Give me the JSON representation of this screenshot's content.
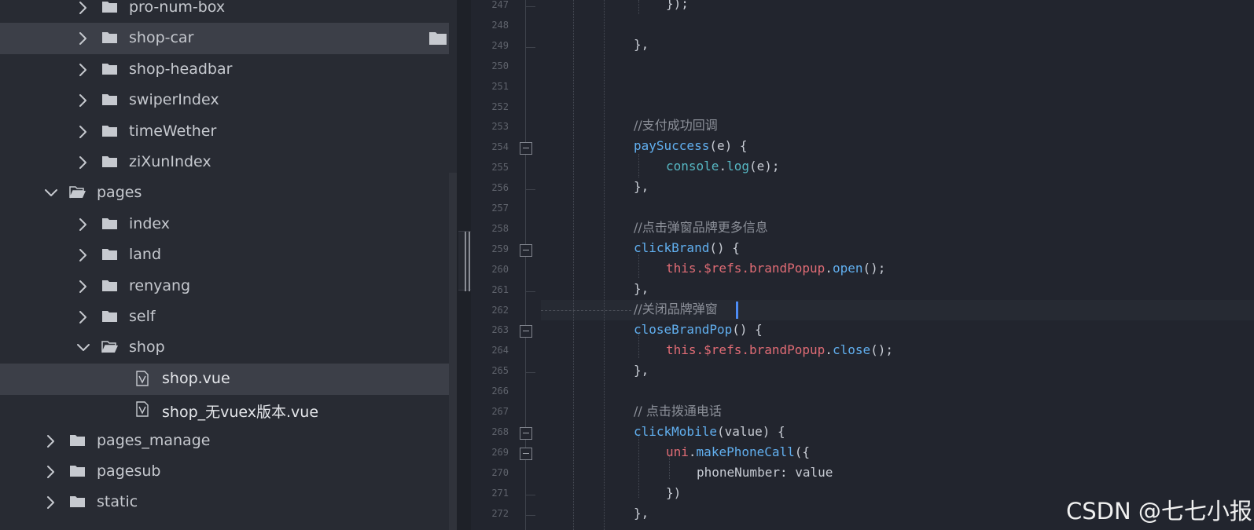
{
  "sidebar": {
    "items": [
      {
        "label": "pro-num-box",
        "type": "folder",
        "expanded": false,
        "depth": 2
      },
      {
        "label": "shop-car",
        "type": "folder",
        "expanded": false,
        "depth": 2,
        "selected": true
      },
      {
        "label": "shop-headbar",
        "type": "folder",
        "expanded": false,
        "depth": 2
      },
      {
        "label": "swiperIndex",
        "type": "folder",
        "expanded": false,
        "depth": 2
      },
      {
        "label": "timeWether",
        "type": "folder",
        "expanded": false,
        "depth": 2
      },
      {
        "label": "ziXunIndex",
        "type": "folder",
        "expanded": false,
        "depth": 2
      },
      {
        "label": "pages",
        "type": "folder",
        "expanded": true,
        "depth": 1
      },
      {
        "label": "index",
        "type": "folder",
        "expanded": false,
        "depth": 2
      },
      {
        "label": "land",
        "type": "folder",
        "expanded": false,
        "depth": 2
      },
      {
        "label": "renyang",
        "type": "folder",
        "expanded": false,
        "depth": 2
      },
      {
        "label": "self",
        "type": "folder",
        "expanded": false,
        "depth": 2
      },
      {
        "label": "shop",
        "type": "folder",
        "expanded": true,
        "depth": 2
      },
      {
        "label": "shop.vue",
        "type": "file",
        "depth": 3,
        "selected": true
      },
      {
        "label": "shop_无vuex版本.vue",
        "type": "file",
        "depth": 3
      },
      {
        "label": "pages_manage",
        "type": "folder",
        "expanded": false,
        "depth": 1
      },
      {
        "label": "pagesub",
        "type": "folder",
        "expanded": false,
        "depth": 1
      },
      {
        "label": "static",
        "type": "folder",
        "expanded": false,
        "depth": 1
      }
    ]
  },
  "editor": {
    "line_numbers": [
      "247",
      "248",
      "249",
      "250",
      "251",
      "252",
      "253",
      "254",
      "255",
      "256",
      "257",
      "258",
      "259",
      "260",
      "261",
      "262",
      "263",
      "264",
      "265",
      "266",
      "267",
      "268",
      "269",
      "270",
      "271",
      "272"
    ],
    "lines": {
      "l247": "});",
      "l249": "},",
      "l253": "//支付成功回调",
      "l254_fn": "paySuccess",
      "l254_rest": "(e) {",
      "l255_obj": "console",
      "l255_dot": ".",
      "l255_fn": "log",
      "l255_rest": "(e);",
      "l256": "},",
      "l258": "//点击弹窗品牌更多信息",
      "l259_fn": "clickBrand",
      "l259_rest": "() {",
      "l260_this": "this",
      "l260_refs": ".$refs.",
      "l260_popup": "brandPopup",
      "l260_dot": ".",
      "l260_fn": "open",
      "l260_rest": "();",
      "l261": "},",
      "l262": "//关闭品牌弹窗",
      "l263_fn": "closeBrandPop",
      "l263_rest": "() {",
      "l264_this": "this",
      "l264_refs": ".$refs.",
      "l264_popup": "brandPopup",
      "l264_dot": ".",
      "l264_fn": "close",
      "l264_rest": "();",
      "l265": "},",
      "l267": "// 点击拨通电话",
      "l268_fn": "clickMobile",
      "l268_rest": "(value) {",
      "l269_obj": "uni",
      "l269_dot": ".",
      "l269_fn": "makePhoneCall",
      "l269_rest": "({",
      "l270": "phoneNumber: value",
      "l271": "})",
      "l272": "},"
    }
  },
  "watermark": "CSDN @七七小报",
  "icons": {
    "chevron_right": "chevron-right-icon",
    "chevron_down": "chevron-down-icon",
    "folder": "folder-icon",
    "folder_open": "folder-open-icon",
    "vue_file": "vue-file-icon"
  },
  "colors": {
    "sidebar_bg": "#282b33",
    "editor_bg": "#22252e",
    "selection": "#3c3f48",
    "function": "#61afef",
    "keyword": "#e06c75",
    "comment": "#8c9099",
    "caret": "#4d8cf5"
  }
}
